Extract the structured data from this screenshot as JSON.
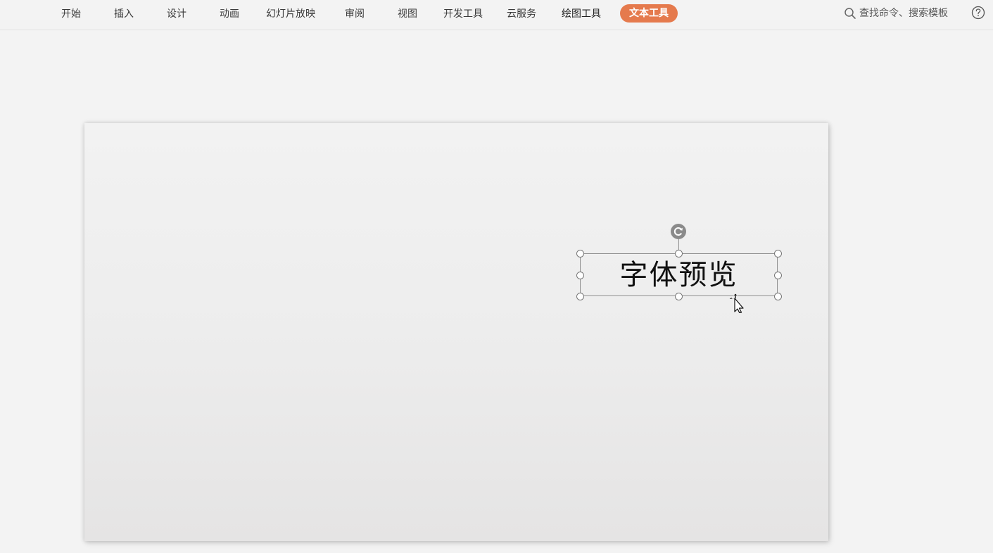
{
  "ribbon": {
    "tabs": [
      {
        "label": "开始"
      },
      {
        "label": "插入"
      },
      {
        "label": "设计"
      },
      {
        "label": "动画"
      },
      {
        "label": "幻灯片放映"
      },
      {
        "label": "审阅"
      },
      {
        "label": "视图"
      },
      {
        "label": "开发工具"
      },
      {
        "label": "云服务"
      },
      {
        "label": "绘图工具"
      },
      {
        "label": "文本工具"
      }
    ],
    "active_tab": "文本工具",
    "search": {
      "label": "查找命令、搜索模板",
      "icon": "search-icon"
    },
    "help_icon": "help-icon"
  },
  "slide": {
    "textbox": {
      "text": "字体预览"
    }
  },
  "colors": {
    "accent": "#e57a4d",
    "background": "#f3f3f3"
  }
}
